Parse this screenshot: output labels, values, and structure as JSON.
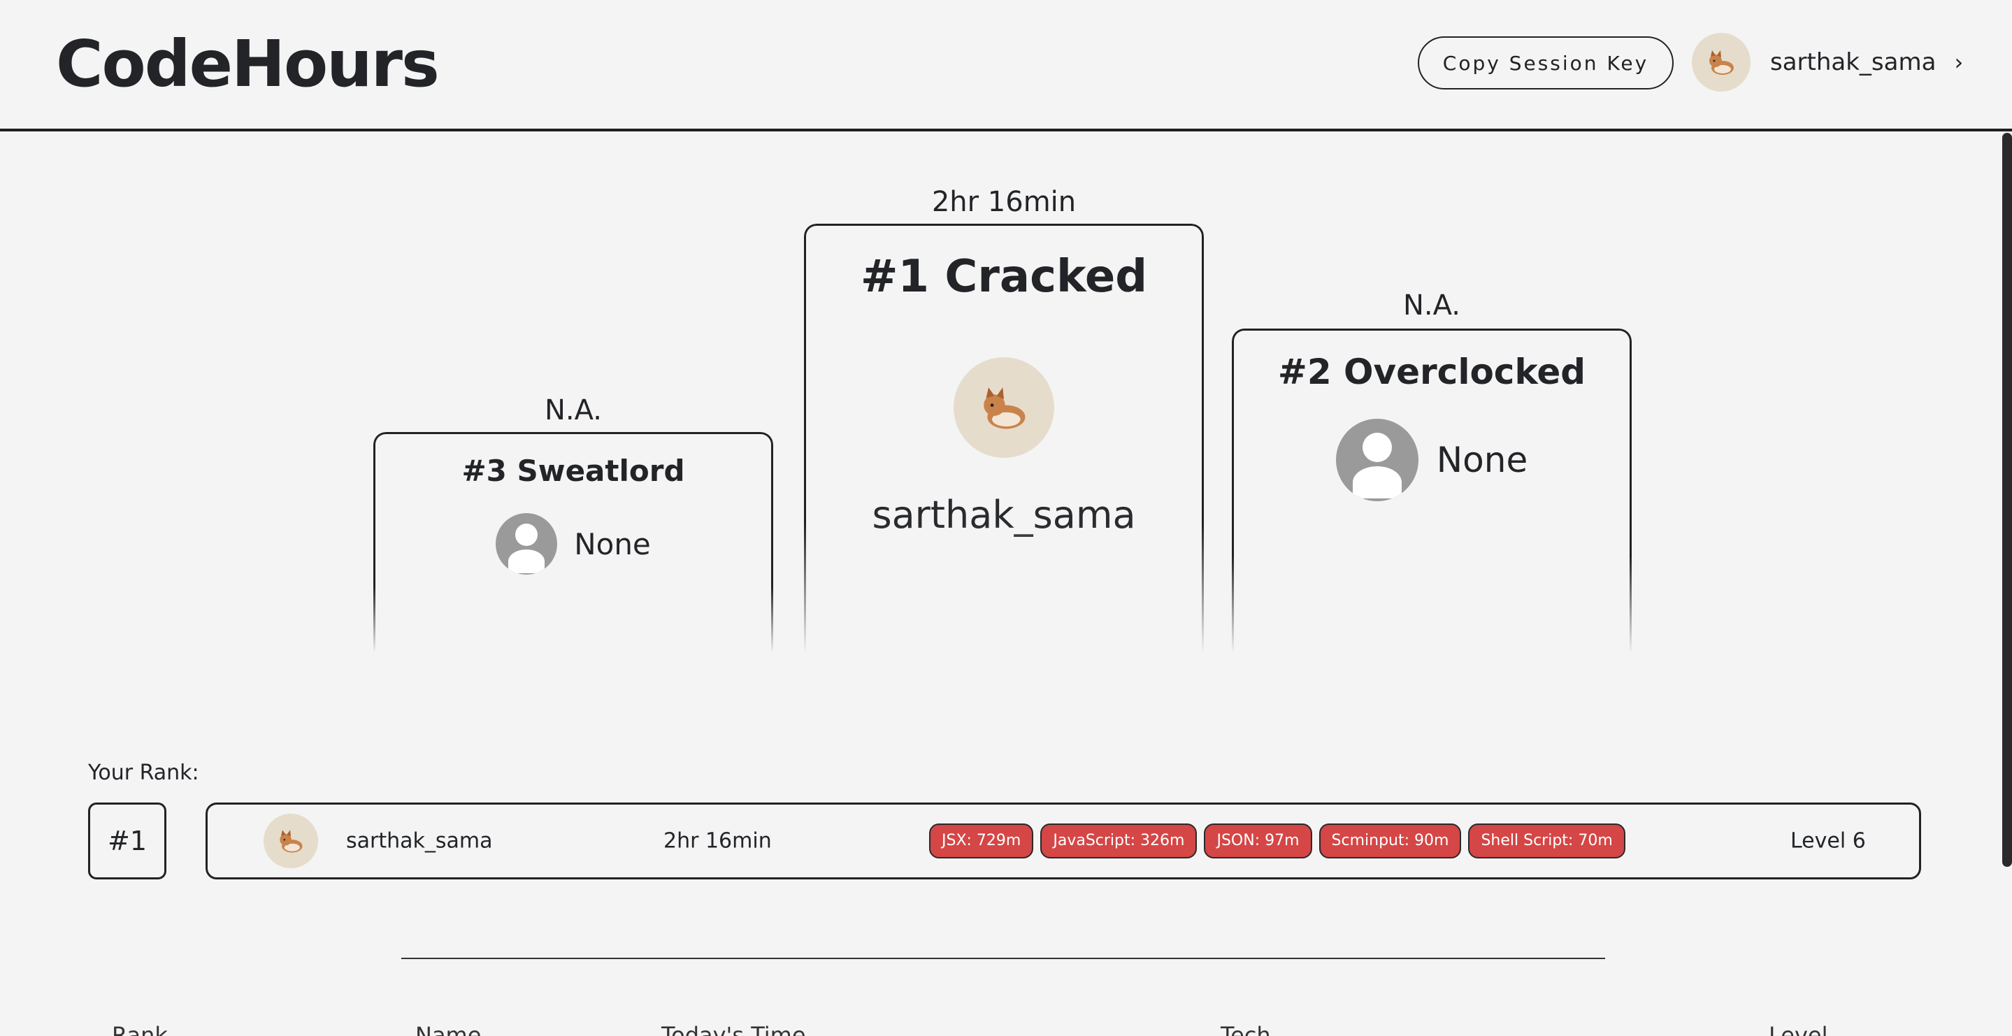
{
  "header": {
    "logo": "CodeHours",
    "copy_button": "Copy Session Key",
    "username": "sarthak_sama",
    "chevron": "›"
  },
  "podium": {
    "first": {
      "time": "2hr 16min",
      "title": "#1 Cracked",
      "user": "sarthak_sama"
    },
    "second": {
      "time": "N.A.",
      "title": "#2 Overclocked",
      "user": "None"
    },
    "third": {
      "time": "N.A.",
      "title": "#3 Sweatlord",
      "user": "None"
    }
  },
  "your_rank": {
    "caption": "Your Rank:",
    "rank": "#1",
    "username": "sarthak_sama",
    "time": "2hr 16min",
    "languages": [
      {
        "label": "JSX: 729m"
      },
      {
        "label": "JavaScript: 326m"
      },
      {
        "label": "JSON: 97m"
      },
      {
        "label": "Scminput: 90m"
      },
      {
        "label": "Shell Script: 70m"
      }
    ],
    "level": "Level 6"
  },
  "table_header": {
    "rank": "Rank",
    "name": "Name",
    "time": "Today's Time",
    "tech": "Tech",
    "level": "Level"
  },
  "colors": {
    "chip": "#d54646",
    "avatar_bg": "#e6dccb",
    "generic_avatar": "#9a9a9a"
  }
}
